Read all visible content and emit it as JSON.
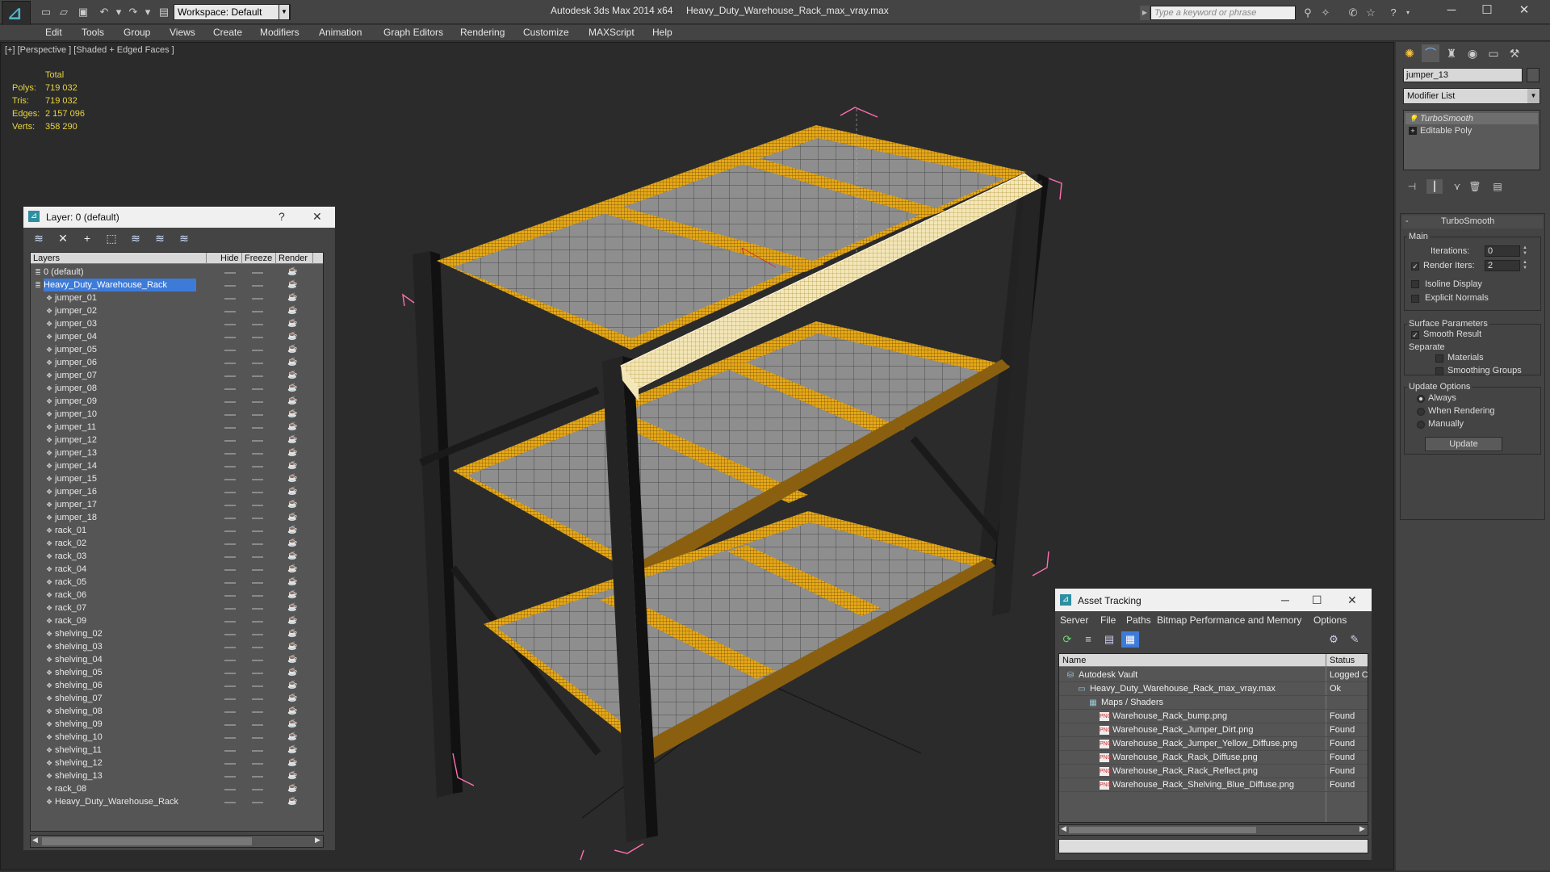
{
  "titlebar": {
    "app_title": "Autodesk 3ds Max  2014 x64",
    "file_title": "Heavy_Duty_Warehouse_Rack_max_vray.max",
    "workspace": "Workspace: Default",
    "search_placeholder": "Type a keyword or phrase"
  },
  "menubar": [
    "Edit",
    "Tools",
    "Group",
    "Views",
    "Create",
    "Modifiers",
    "Animation",
    "Graph Editors",
    "Rendering",
    "Customize",
    "MAXScript",
    "Help"
  ],
  "viewport": {
    "label": "[+] [Perspective ] [Shaded + Edged Faces ]",
    "stats_header": "Total",
    "stats": [
      {
        "label": "Polys:",
        "value": "719 032"
      },
      {
        "label": "Tris:",
        "value": "719 032"
      },
      {
        "label": "Edges:",
        "value": "2 157 096"
      },
      {
        "label": "Verts:",
        "value": "358 290"
      }
    ]
  },
  "command_panel": {
    "object_name": "jumper_13",
    "modifier_list": "Modifier List",
    "stack": [
      "TurboSmooth",
      "Editable Poly"
    ],
    "rollout_title": "TurboSmooth",
    "main_label": "Main",
    "iterations_label": "Iterations:",
    "iterations_value": "0",
    "render_iters_label": "Render Iters:",
    "render_iters_value": "2",
    "isoline_label": "Isoline Display",
    "explicit_label": "Explicit Normals",
    "surface_label": "Surface Parameters",
    "smooth_label": "Smooth Result",
    "separate_label": "Separate",
    "materials_label": "Materials",
    "smoothing_label": "Smoothing Groups",
    "update_options_label": "Update Options",
    "always_label": "Always",
    "when_rendering_label": "When Rendering",
    "manually_label": "Manually",
    "update_button": "Update"
  },
  "layer_window": {
    "title": "Layer: 0 (default)",
    "help": "?",
    "columns": [
      "Layers",
      "Hide",
      "Freeze",
      "Render"
    ],
    "rows": [
      "0 (default)",
      "Heavy_Duty_Warehouse_Rack",
      "jumper_01",
      "jumper_02",
      "jumper_03",
      "jumper_04",
      "jumper_05",
      "jumper_06",
      "jumper_07",
      "jumper_08",
      "jumper_09",
      "jumper_10",
      "jumper_11",
      "jumper_12",
      "jumper_13",
      "jumper_14",
      "jumper_15",
      "jumper_16",
      "jumper_17",
      "jumper_18",
      "rack_01",
      "rack_02",
      "rack_03",
      "rack_04",
      "rack_05",
      "rack_06",
      "rack_07",
      "rack_09",
      "shelving_02",
      "shelving_03",
      "shelving_04",
      "shelving_05",
      "shelving_06",
      "shelving_07",
      "shelving_08",
      "shelving_09",
      "shelving_10",
      "shelving_11",
      "shelving_12",
      "shelving_13",
      "rack_08",
      "Heavy_Duty_Warehouse_Rack"
    ]
  },
  "asset_window": {
    "title": "Asset Tracking",
    "menu": [
      "Server",
      "File",
      "Paths",
      "Bitmap Performance and Memory",
      "Options"
    ],
    "columns": [
      "Name",
      "Status"
    ],
    "rows": [
      {
        "name": "Autodesk Vault",
        "status": "Logged C",
        "depth": 0,
        "icon": "vault-icon"
      },
      {
        "name": "Heavy_Duty_Warehouse_Rack_max_vray.max",
        "status": "Ok",
        "depth": 1,
        "icon": "max-file-icon"
      },
      {
        "name": "Maps / Shaders",
        "status": "",
        "depth": 2,
        "icon": "maps-icon"
      },
      {
        "name": "Warehouse_Rack_bump.png",
        "status": "Found",
        "depth": 3,
        "icon": "png-icon"
      },
      {
        "name": "Warehouse_Rack_Jumper_Dirt.png",
        "status": "Found",
        "depth": 3,
        "icon": "png-icon"
      },
      {
        "name": "Warehouse_Rack_Jumper_Yellow_Diffuse.png",
        "status": "Found",
        "depth": 3,
        "icon": "png-icon"
      },
      {
        "name": "Warehouse_Rack_Rack_Diffuse.png",
        "status": "Found",
        "depth": 3,
        "icon": "png-icon"
      },
      {
        "name": "Warehouse_Rack_Rack_Reflect.png",
        "status": "Found",
        "depth": 3,
        "icon": "png-icon"
      },
      {
        "name": "Warehouse_Rack_Shelving_Blue_Diffuse.png",
        "status": "Found",
        "depth": 3,
        "icon": "png-icon"
      }
    ]
  },
  "colors": {
    "accent": "#4fb5c8",
    "selection": "#3d7bd9",
    "stat_text": "#e8d440",
    "shelf_yellow": "#f0b21e",
    "bounding_box": "#ff6fb0"
  }
}
